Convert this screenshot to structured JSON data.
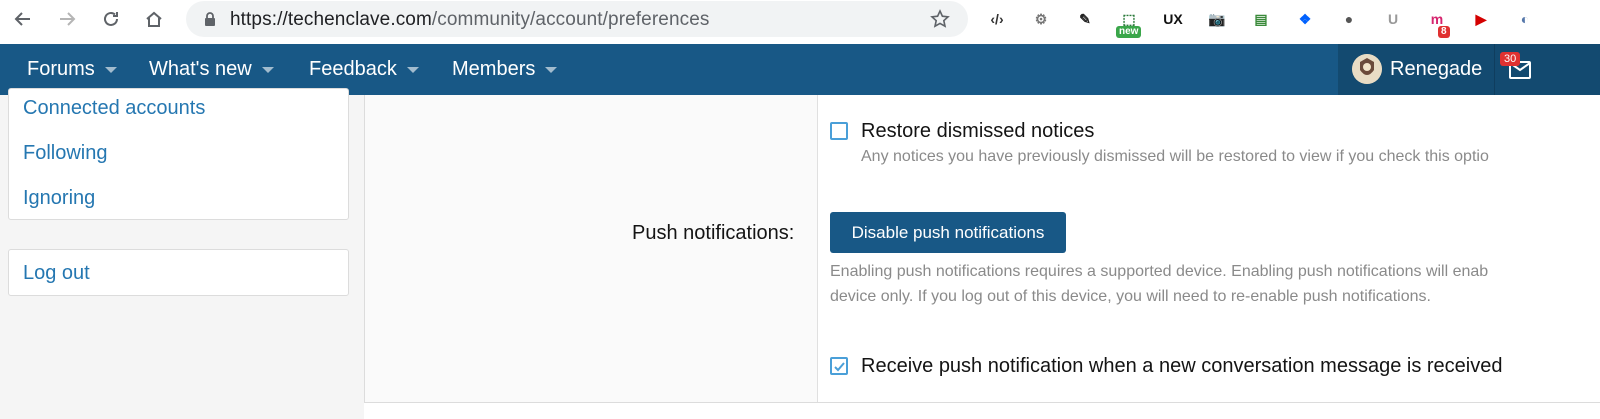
{
  "browser": {
    "url_host": "https://techenclave.com",
    "url_path": "/community/account/preferences",
    "extensions": [
      {
        "name": "code-icon",
        "label": "‹/›"
      },
      {
        "name": "gear-extension-icon",
        "label": "⚙"
      },
      {
        "name": "eyedropper-icon",
        "label": "✎"
      },
      {
        "name": "capture-icon",
        "label": "⬚",
        "badge": "new"
      },
      {
        "name": "ux-check-icon",
        "label": "UX"
      },
      {
        "name": "camera-icon",
        "label": "📷"
      },
      {
        "name": "sheet-icon",
        "label": "▤"
      },
      {
        "name": "dropbox-icon",
        "label": "❖"
      },
      {
        "name": "circle-icon",
        "label": "●"
      },
      {
        "name": "u-icon",
        "label": "U"
      },
      {
        "name": "m-icon",
        "label": "m",
        "badge": "8"
      },
      {
        "name": "play-icon",
        "label": "▶"
      },
      {
        "name": "shield-ext-icon",
        "label": "◐"
      }
    ]
  },
  "nav": {
    "tabs": [
      "Forums",
      "What's new",
      "Feedback",
      "Members"
    ],
    "username": "Renegade",
    "inbox_count": "30"
  },
  "sidebar": {
    "links": [
      "Connected accounts",
      "Following",
      "Ignoring"
    ],
    "logout": "Log out"
  },
  "preferences": {
    "restore_label": "Restore dismissed notices",
    "restore_hint": "Any notices you have previously dismissed will be restored to view if you check this optio",
    "push_label": "Push notifications:",
    "push_button": "Disable push notifications",
    "push_hint_line1": "Enabling push notifications requires a supported device. Enabling push notifications will enab",
    "push_hint_line2": "device only. If you log out of this device, you will need to re-enable push notifications.",
    "receive_label": "Receive push notification when a new conversation message is received",
    "restore_checked": false,
    "receive_checked": true
  },
  "colors": {
    "nav_bg": "#185886",
    "link": "#2577b1",
    "checkbox_border": "#4a9fd8"
  }
}
